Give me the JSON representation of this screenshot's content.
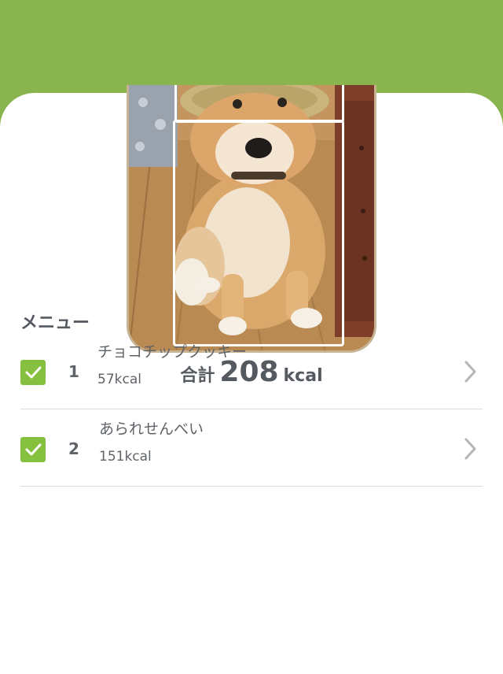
{
  "colors": {
    "header_green": "#8ab44e",
    "checkbox_green": "#86c03f",
    "text": "#555a60"
  },
  "total": {
    "label": "合計",
    "value": "208",
    "unit": "kcal"
  },
  "menu": {
    "heading": "メニュー",
    "items": [
      {
        "checked": true,
        "index": "1",
        "name": "チョコチップクッキー",
        "kcal": "57kcal"
      },
      {
        "checked": true,
        "index": "2",
        "name": "あられせんべい",
        "kcal": "151kcal"
      }
    ]
  },
  "icons": {
    "checkbox": "check-icon",
    "row_chevron": "chevron-right-icon"
  }
}
